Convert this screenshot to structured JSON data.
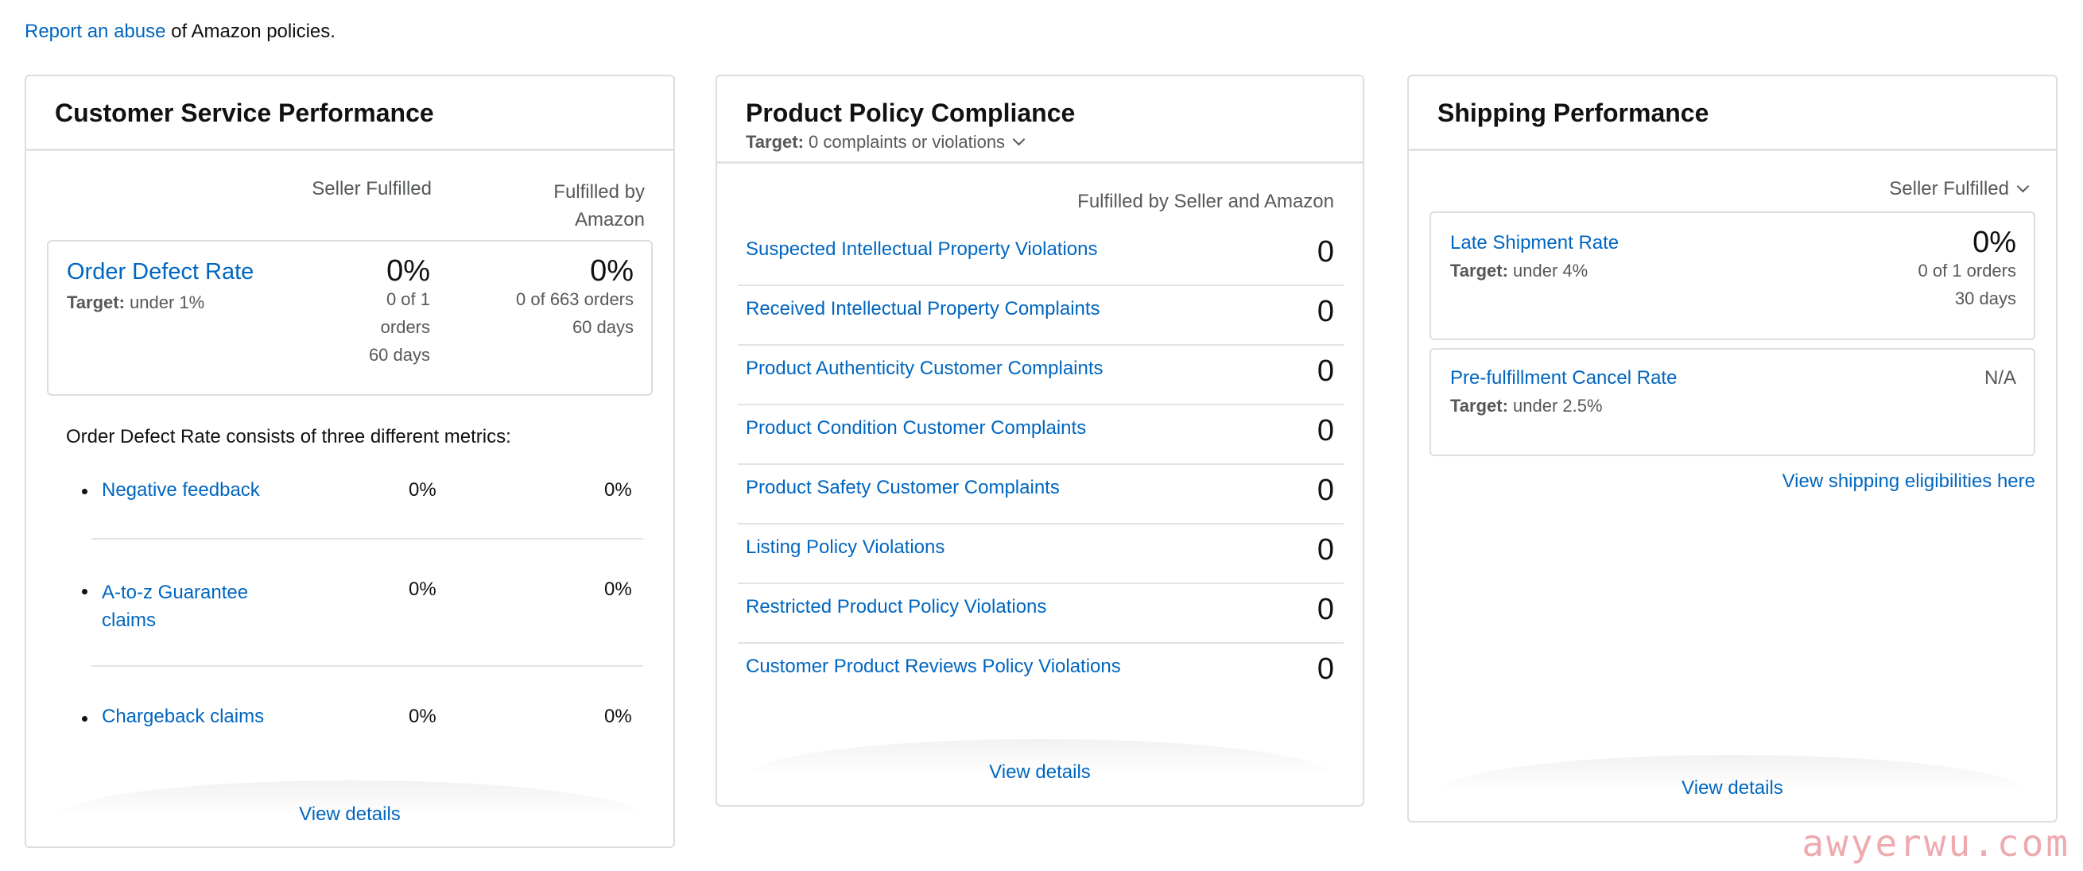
{
  "top_note": {
    "link": "Report an abuse",
    "rest": " of Amazon policies."
  },
  "customer_service": {
    "title": "Customer Service Performance",
    "col_seller": "Seller Fulfilled",
    "col_fba_line1": "Fulfilled by",
    "col_fba_line2": "Amazon",
    "odr": {
      "label": "Order Defect Rate",
      "target_label": "Target:",
      "target_value": " under 1%",
      "seller_pct": "0%",
      "seller_line1": "0 of 1",
      "seller_line2": "orders",
      "seller_days": "60 days",
      "fba_pct": "0%",
      "fba_line1": "0 of 663 orders",
      "fba_days": "60 days"
    },
    "consists_text": "Order Defect Rate consists of three different metrics:",
    "metrics": [
      {
        "label": "Negative feedback",
        "seller": "0%",
        "fba": "0%"
      },
      {
        "label_line1": "A-to-z Guarantee",
        "label_line2": "claims",
        "seller": "0%",
        "fba": "0%"
      },
      {
        "label": "Chargeback claims",
        "seller": "0%",
        "fba": "0%"
      }
    ],
    "view_details": "View details"
  },
  "product_policy": {
    "title": "Product Policy Compliance",
    "target_label": "Target:",
    "target_value": " 0 complaints or violations",
    "column_header": "Fulfilled by Seller and Amazon",
    "rows": [
      {
        "label": "Suspected Intellectual Property Violations",
        "value": "0"
      },
      {
        "label": "Received Intellectual Property Complaints",
        "value": "0"
      },
      {
        "label": "Product Authenticity Customer Complaints",
        "value": "0"
      },
      {
        "label": "Product Condition Customer Complaints",
        "value": "0"
      },
      {
        "label": "Product Safety Customer Complaints",
        "value": "0"
      },
      {
        "label": "Listing Policy Violations",
        "value": "0"
      },
      {
        "label": "Restricted Product Policy Violations",
        "value": "0"
      },
      {
        "label": "Customer Product Reviews Policy Violations",
        "value": "0"
      }
    ],
    "view_details": "View details"
  },
  "shipping": {
    "title": "Shipping Performance",
    "selector": "Seller Fulfilled",
    "late_shipment": {
      "label": "Late Shipment Rate",
      "target_label": "Target:",
      "target_value": " under 4%",
      "pct": "0%",
      "orders": "0 of 1 orders",
      "days": "30 days"
    },
    "cancel_rate": {
      "label": "Pre-fulfillment Cancel Rate",
      "target_label": "Target:",
      "target_value": " under 2.5%",
      "value": "N/A"
    },
    "eligibility_link": "View shipping eligibilities here",
    "view_details": "View details"
  },
  "watermark": "awyerwu.com"
}
